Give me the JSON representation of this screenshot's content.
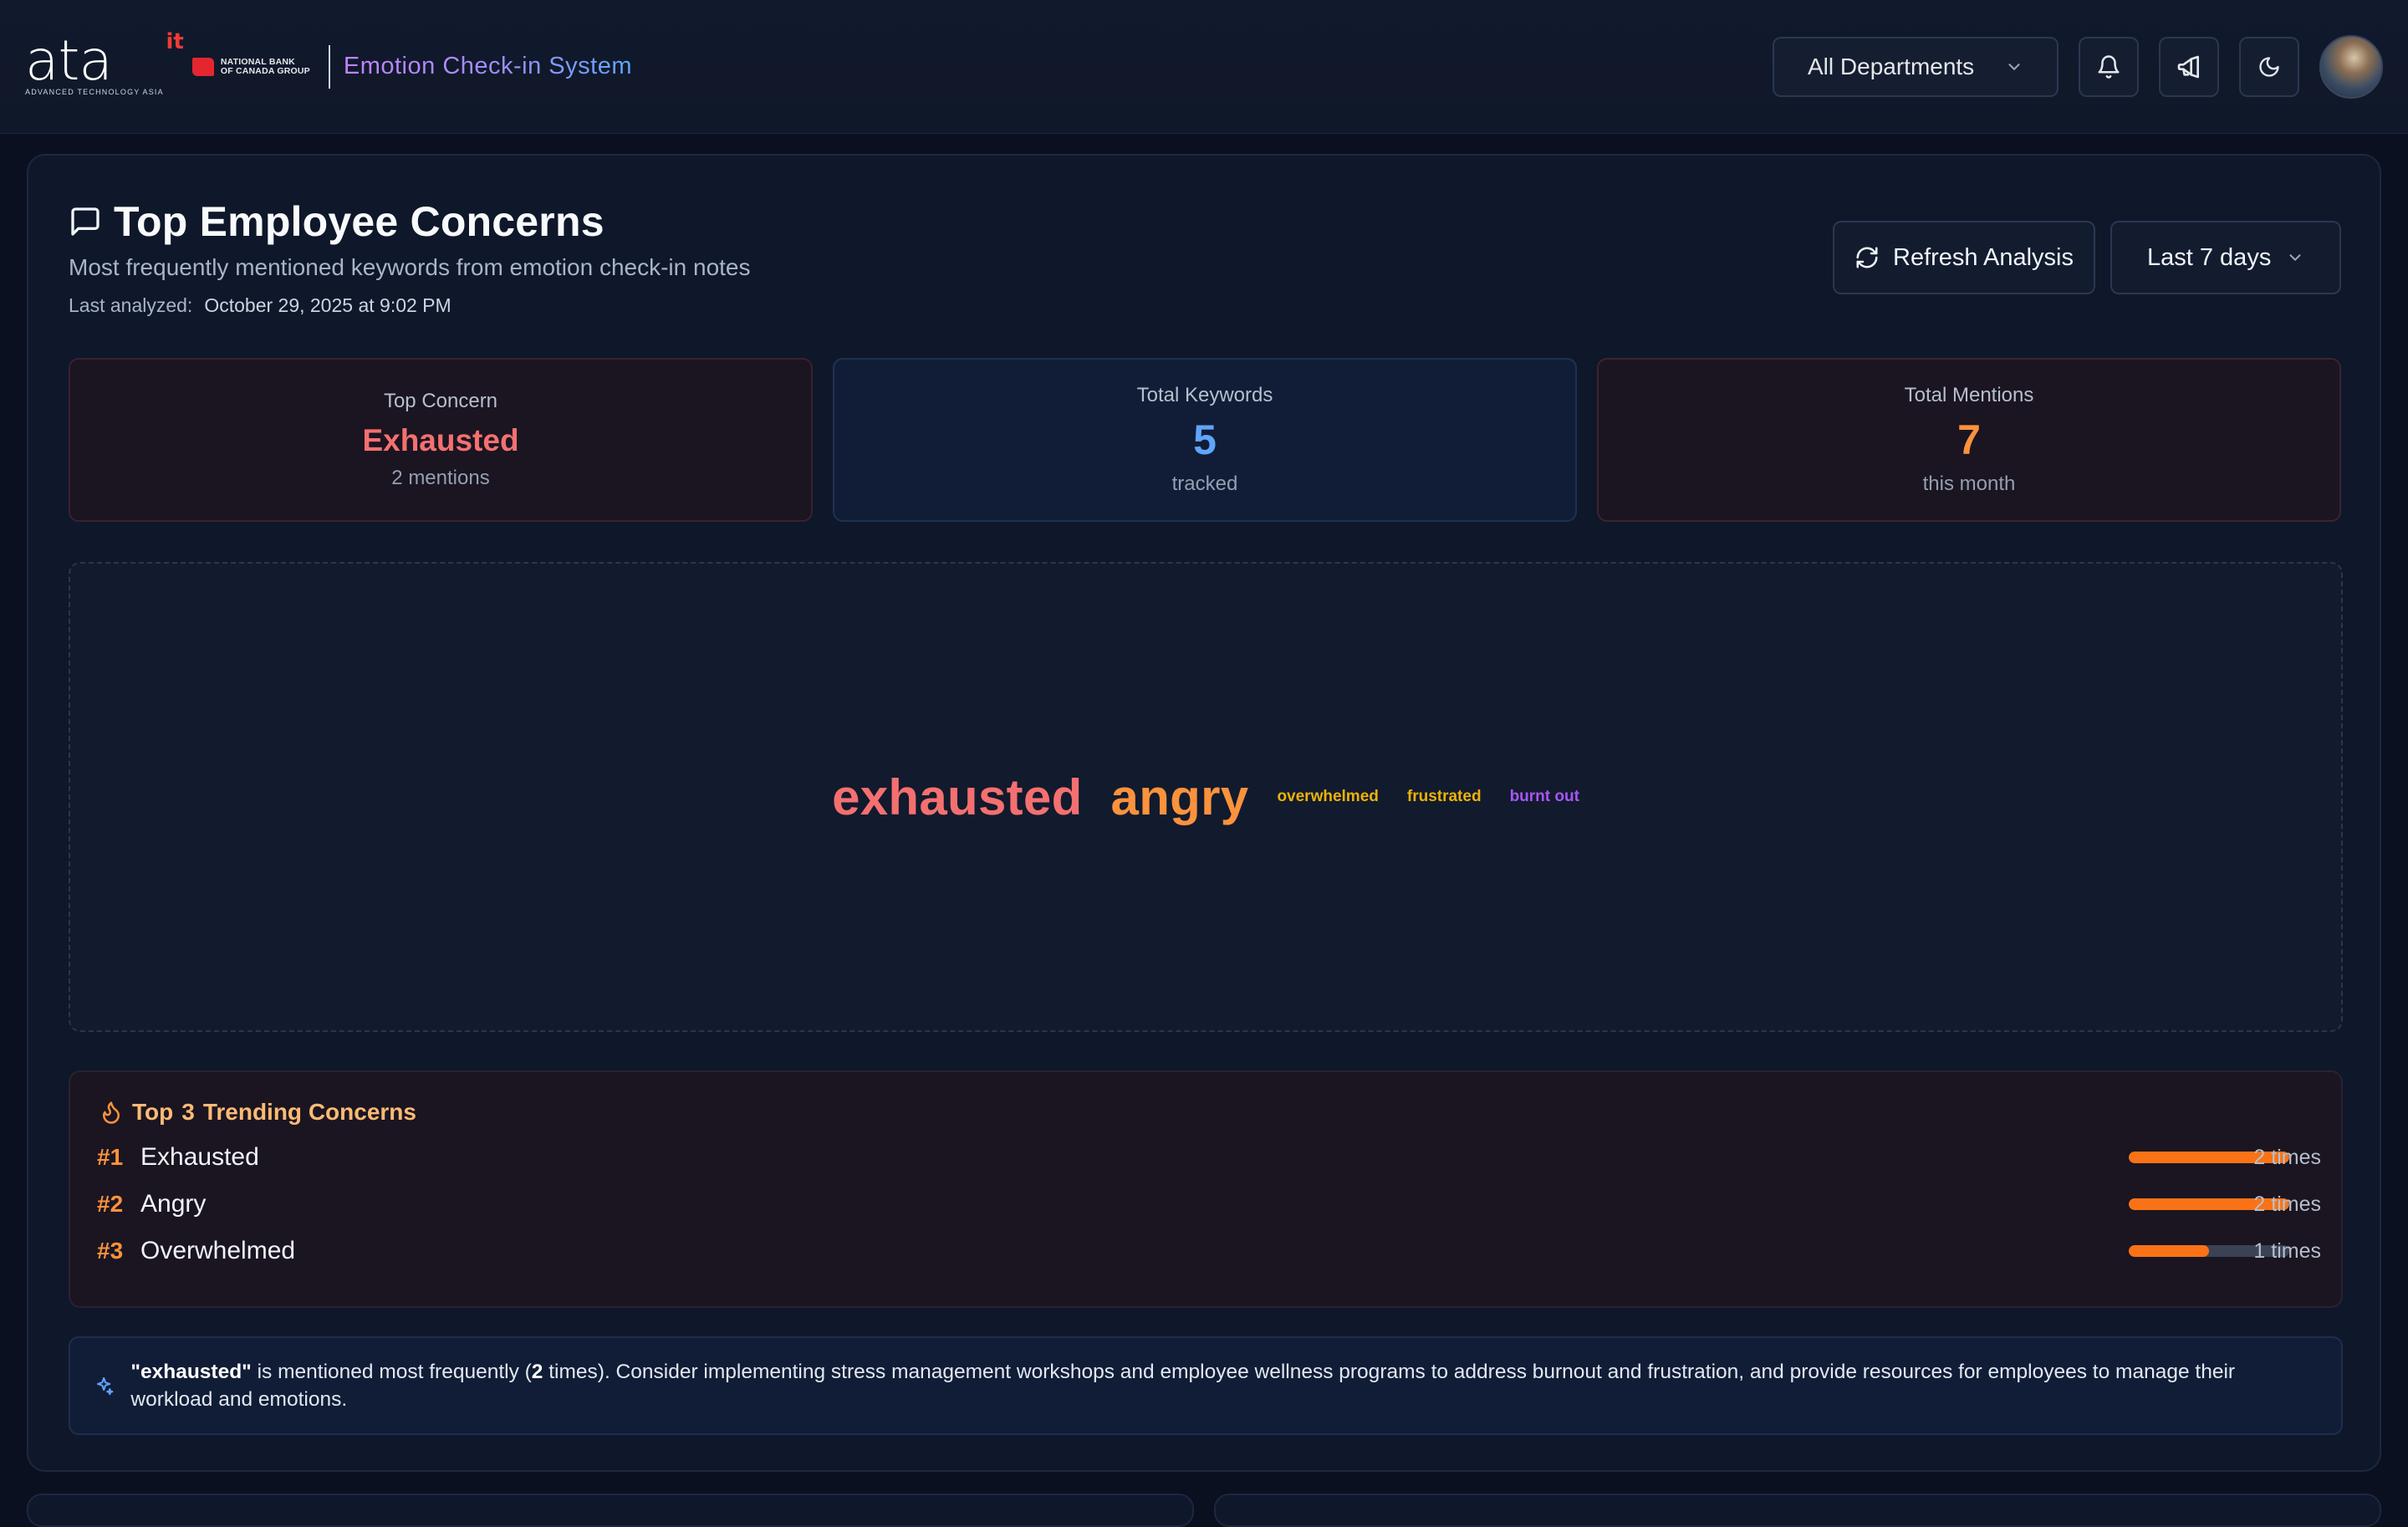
{
  "header": {
    "logo_text": "ata",
    "logo_superscript": "it",
    "logo_tagline": "ADVANCED TECHNOLOGY ASIA",
    "partner_line1": "NATIONAL BANK",
    "partner_line2": "OF CANADA GROUP",
    "app_title": "Emotion Check-in System",
    "department_filter": "All Departments",
    "icons": [
      "bell-icon",
      "megaphone-icon",
      "moon-icon"
    ]
  },
  "concerns": {
    "title": "Top Employee Concerns",
    "subtitle": "Most frequently mentioned keywords from emotion check-in notes",
    "last_analyzed_label": "Last analyzed:",
    "last_analyzed_value": "October 29, 2025 at 9:02 PM",
    "refresh_label": "Refresh Analysis",
    "range_label": "Last 7 days"
  },
  "stats": {
    "top_concern": {
      "label": "Top Concern",
      "value": "Exhausted",
      "sub": "2 mentions",
      "color": "#f47070"
    },
    "total_keywords": {
      "label": "Total Keywords",
      "value": "5",
      "sub": "tracked",
      "color": "#60a5fa"
    },
    "total_mentions": {
      "label": "Total Mentions",
      "value": "7",
      "sub": "this month",
      "color": "#fb923c"
    }
  },
  "word_cloud": [
    {
      "word": "exhausted",
      "color": "#f47070"
    },
    {
      "word": "angry",
      "color": "#fb923c"
    },
    {
      "word": "overwhelmed",
      "color": "#eab308"
    },
    {
      "word": "frustrated",
      "color": "#eab308"
    },
    {
      "word": "burnt out",
      "color": "#a855f7"
    }
  ],
  "trending": {
    "title_prefix": "Top",
    "title_count": "3",
    "title_suffix": "Trending Concerns",
    "items": [
      {
        "rank": "#1",
        "name": "Exhausted",
        "count": "2 times",
        "fraction": 1.0
      },
      {
        "rank": "#2",
        "name": "Angry",
        "count": "2 times",
        "fraction": 1.0
      },
      {
        "rank": "#3",
        "name": "Overwhelmed",
        "count": "1 times",
        "fraction": 0.5
      }
    ]
  },
  "insight": {
    "keyword": "\"exhausted\"",
    "text_before": " is mentioned most frequently (",
    "count": "2",
    "text_after": " times). Consider implementing stress management workshops and employee wellness programs to address burnout and frustration, and provide resources for employees to manage their workload and emotions."
  },
  "colors": {
    "accent_orange": "#f97316",
    "accent_blue": "#60a5fa",
    "accent_red": "#f47070"
  }
}
